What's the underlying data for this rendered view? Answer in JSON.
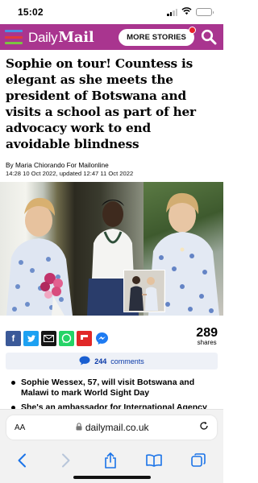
{
  "status_bar": {
    "time": "15:02"
  },
  "header": {
    "logo_daily": "Daily",
    "logo_mail": "Mail",
    "more_stories": "MORE STORIES",
    "brand_color": "#a9358f",
    "menu_colors": [
      "#4a90e2",
      "#e23b3b",
      "#7cc243"
    ]
  },
  "article": {
    "headline": "Sophie on tour! Countess is elegant as she meets the president of Botswana and visits a school as part of her advocacy work to end avoidable blindness",
    "byline": "By Maria Chiorando For Mailonline",
    "dates": "14:28 10 Oct 2022, updated 12:47 11 Oct 2022",
    "share_count": "289",
    "share_label": "shares",
    "comments_count": "244",
    "comments_label": "comments",
    "bullets": [
      "Sophie Wessex, 57, will visit Botswana and Malawi to mark World Sight Day",
      "She's an ambassador for International Agency for the Prevention of Blindness"
    ]
  },
  "share_icons": [
    "facebook-icon",
    "twitter-icon",
    "email-icon",
    "whatsapp-icon",
    "flipboard-icon",
    "messenger-icon"
  ],
  "browser": {
    "aa_label": "AA",
    "url": "dailymail.co.uk"
  }
}
